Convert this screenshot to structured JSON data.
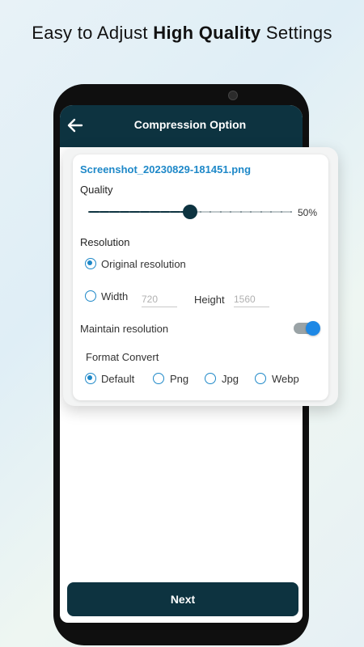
{
  "promo": {
    "headline_regular_1": "Easy to Adjust ",
    "headline_bold": "High Quality",
    "headline_regular_2": " Settings"
  },
  "appbar": {
    "title": "Compression Option",
    "back_icon": "arrow-left-icon"
  },
  "card": {
    "filename": "Screenshot_20230829-181451.png",
    "quality": {
      "label": "Quality",
      "value_percent": 50,
      "value_label": "50%"
    },
    "resolution": {
      "label": "Resolution",
      "original_option": "Original resolution",
      "original_selected": true,
      "custom": {
        "width_label": "Width",
        "width_value": "720",
        "height_label": "Height",
        "height_value": "1560"
      }
    },
    "maintain_resolution": {
      "label": "Maintain resolution",
      "enabled": true
    },
    "format_convert": {
      "label": "Format Convert",
      "options": [
        "Default",
        "Png",
        "Jpg",
        "Webp"
      ],
      "selected": "Default"
    }
  },
  "next_button": {
    "label": "Next"
  },
  "colors": {
    "primary_dark": "#0d3340",
    "accent_blue": "#1e88c8",
    "toggle_on": "#1e88e5"
  }
}
